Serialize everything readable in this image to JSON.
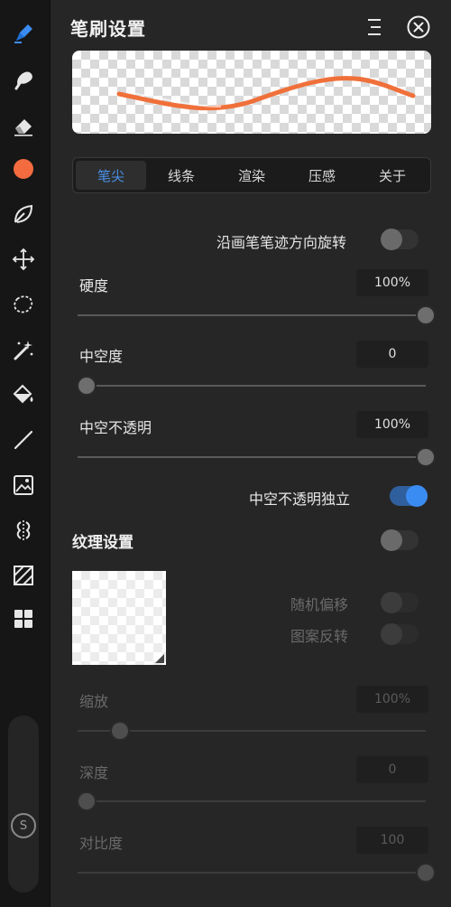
{
  "panel": {
    "title": "笔刷设置"
  },
  "tabs": [
    {
      "label": "笔尖",
      "active": true
    },
    {
      "label": "线条",
      "active": false
    },
    {
      "label": "渲染",
      "active": false
    },
    {
      "label": "压感",
      "active": false
    },
    {
      "label": "关于",
      "active": false
    }
  ],
  "rotate_toggle": {
    "label": "沿画笔笔迹方向旋转",
    "on": false
  },
  "hardness": {
    "label": "硬度",
    "value": "100%",
    "level": 1.0
  },
  "hollowness": {
    "label": "中空度",
    "value": "0",
    "level": 0.0
  },
  "hollow_opacity": {
    "label": "中空不透明",
    "value": "100%",
    "level": 1.0
  },
  "hollow_independent": {
    "label": "中空不透明独立",
    "on": true
  },
  "texture": {
    "title": "纹理设置",
    "enabled": false,
    "random_offset": {
      "label": "随机偏移",
      "on": false
    },
    "pattern_invert": {
      "label": "图案反转",
      "on": false
    },
    "scale": {
      "label": "缩放",
      "value": "100%",
      "level": 0.12
    },
    "depth": {
      "label": "深度",
      "value": "0",
      "level": 0.0
    },
    "contrast": {
      "label": "对比度",
      "value": "100",
      "level": 1.0
    }
  },
  "side_slider": {
    "knob_label": "S"
  },
  "colors": {
    "accent": "#3b8cf2",
    "current_color": "#f36b3f",
    "brush_stroke": "#f0703a"
  }
}
